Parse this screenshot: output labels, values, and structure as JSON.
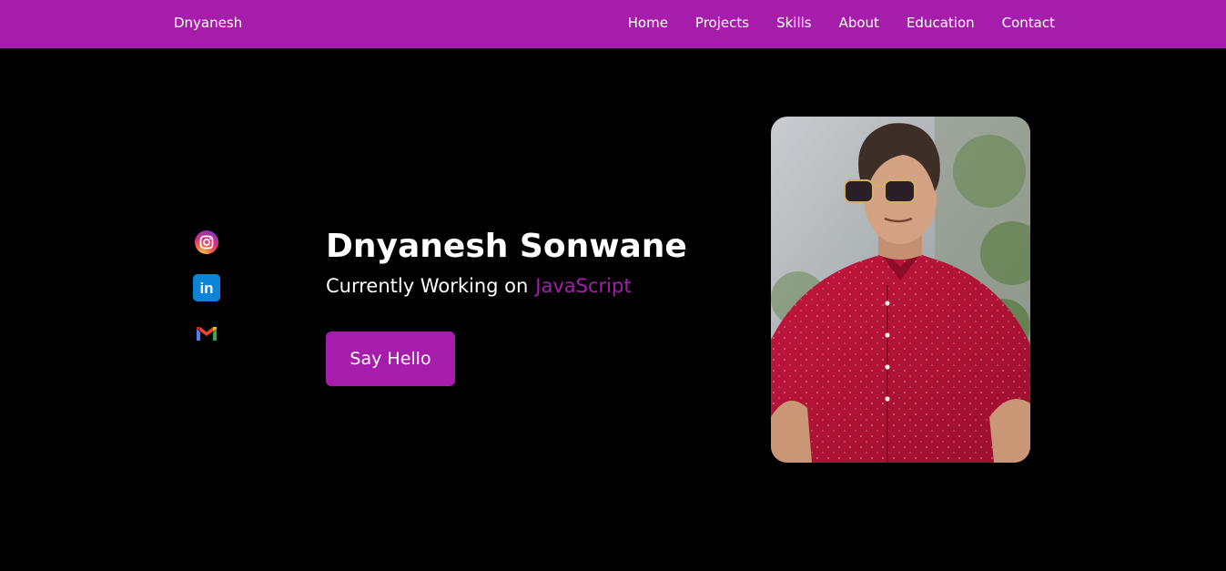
{
  "nav": {
    "brand": "Dnyanesh",
    "links": [
      "Home",
      "Projects",
      "Skills",
      "About",
      "Education",
      "Contact"
    ]
  },
  "socials": [
    {
      "name": "instagram",
      "icon": "instagram-icon"
    },
    {
      "name": "linkedin",
      "icon": "linkedin-icon",
      "label": "in"
    },
    {
      "name": "gmail",
      "icon": "gmail-icon",
      "label": "M"
    }
  ],
  "hero": {
    "name": "Dnyanesh Sonwane",
    "subtitle": "Currently Working on",
    "typed": "JavaScript",
    "button": "Say Hello"
  },
  "colors": {
    "accent": "#a61dac",
    "background": "#000000",
    "text": "#ffffff"
  }
}
